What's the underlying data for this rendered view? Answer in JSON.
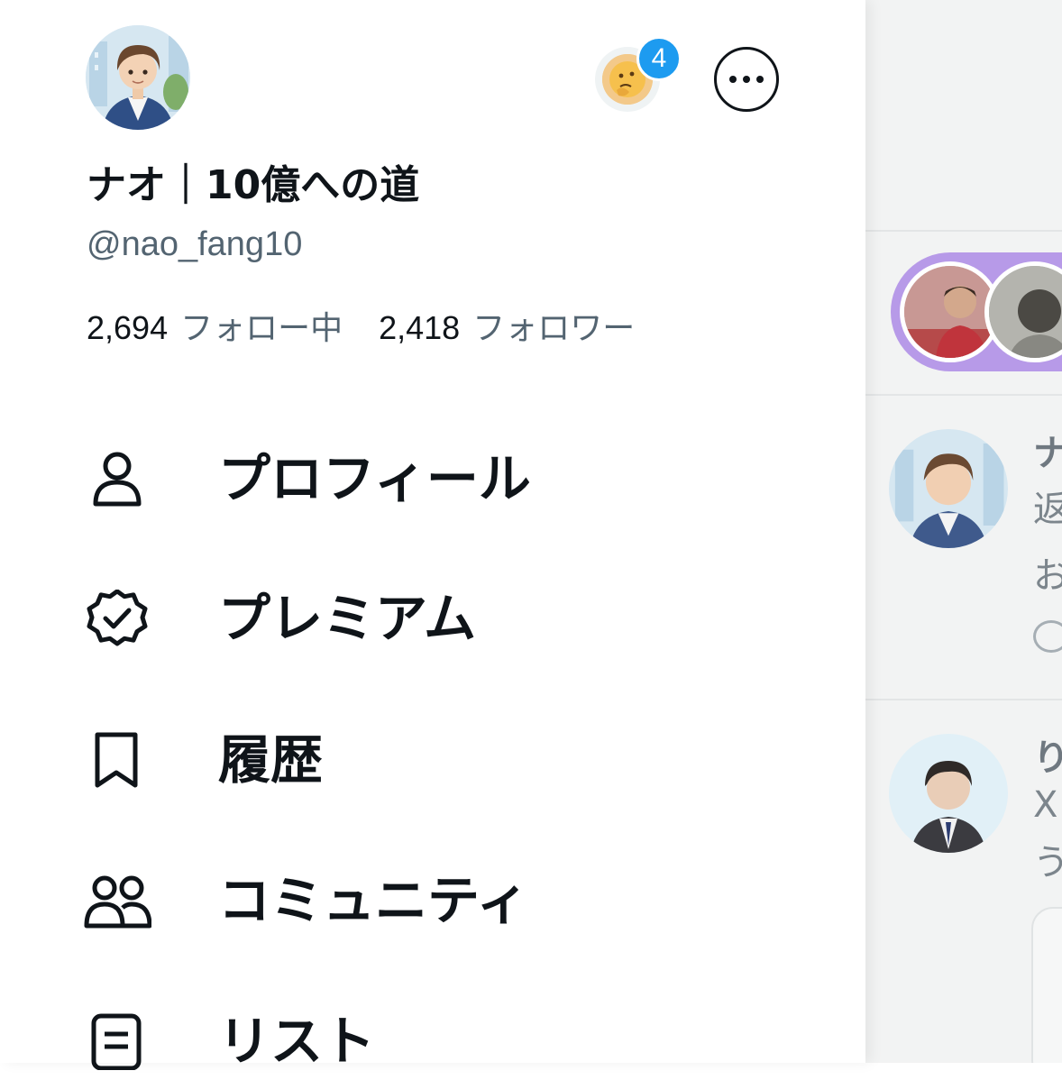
{
  "profile": {
    "display_name": "ナオ｜10億への道",
    "handle": "@nao_fang10",
    "following_count": "2,694",
    "following_label": "フォロー中",
    "followers_count": "2,418",
    "followers_label": "フォロワー",
    "account_badge_count": "4"
  },
  "menu": [
    {
      "label": "プロフィール",
      "icon": "person-icon"
    },
    {
      "label": "プレミアム",
      "icon": "verified-badge-icon"
    },
    {
      "label": "履歴",
      "icon": "bookmark-icon"
    },
    {
      "label": "コミュニティ",
      "icon": "people-icon"
    },
    {
      "label": "リスト",
      "icon": "list-icon"
    }
  ],
  "background_feed": {
    "post1": {
      "name_fragment": "ナ",
      "line2": "返",
      "line3": "お"
    },
    "post2": {
      "name_fragment": "り",
      "line2": "X",
      "line3": "う"
    }
  },
  "colors": {
    "accent": "#1d9bf0",
    "text_primary": "#0f1419",
    "text_secondary": "#536471",
    "fleet_ring": "#b79ae8"
  }
}
